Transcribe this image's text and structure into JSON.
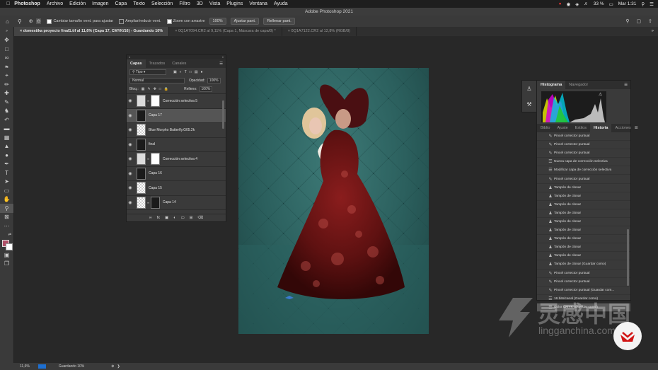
{
  "menubar": {
    "app": "Photoshop",
    "items": [
      "Archivo",
      "Edición",
      "Imagen",
      "Capa",
      "Texto",
      "Selección",
      "Filtro",
      "3D",
      "Vista",
      "Plugins",
      "Ventana",
      "Ayuda"
    ],
    "battery": "33 %",
    "clock": "Mar 1:31"
  },
  "window": {
    "title": "Adobe Photoshop 2021"
  },
  "options": {
    "resize_windows": "Cambiar tamaño vent. para ajustar",
    "zoom_all": "Ampliar/reducir vent.",
    "scrubby": "Zoom con arrastre",
    "zoom_value": "100%",
    "fit_screen": "Ajustar pant.",
    "fill_screen": "Rellenar pant."
  },
  "tabs": [
    "domestika proyecto final1.tif al 11,6% (Capa 17, CMYK/16) - Guardando 10%",
    "0Q1A7094.CR2 al 9,11% (Capa 1, Máscara de capa/8) *",
    "0Q1A7122.CR2 al 12,8% (RGB/8)"
  ],
  "layers_panel": {
    "tabs": [
      "Capas",
      "Trazados",
      "Canales"
    ],
    "filter": "Tipo",
    "blend_mode": "Normal",
    "opacity_label": "Opacidad:",
    "opacity_value": "100%",
    "lock_label": "Bloq.:",
    "fill_label": "Relleno:",
    "fill_value": "100%",
    "layers": [
      {
        "name": "Corrección selectiva 5",
        "kind": "adj"
      },
      {
        "name": "Capa 17",
        "kind": "dark"
      },
      {
        "name": "Blue Morpho Butterfly.G05.2k",
        "kind": "trans"
      },
      {
        "name": "final",
        "kind": "dark"
      },
      {
        "name": "Corrección selectiva 4",
        "kind": "adj"
      },
      {
        "name": "Capa 16",
        "kind": "dark"
      },
      {
        "name": "Capa 15",
        "kind": "trans"
      },
      {
        "name": "Capa 14",
        "kind": "mask"
      }
    ]
  },
  "histogram_panel": {
    "tabs": [
      "Histograma",
      "Navegador"
    ]
  },
  "history_panel": {
    "tabs": [
      "Biblio",
      "Ajuste",
      "Estilos",
      "Historia",
      "Acciones"
    ],
    "items": [
      {
        "label": "Pincel corrector puntual",
        "icon": "brush-icon"
      },
      {
        "label": "Pincel corrector puntual",
        "icon": "brush-icon"
      },
      {
        "label": "Pincel corrector puntual",
        "icon": "brush-icon"
      },
      {
        "label": "Nueva capa de corrección selectiva",
        "icon": "doc-icon"
      },
      {
        "label": "Modificar capa de corrección selectiva",
        "icon": "doc-icon"
      },
      {
        "label": "Pincel corrector puntual",
        "icon": "brush-icon"
      },
      {
        "label": "Tampón de clonar",
        "icon": "stamp-icon"
      },
      {
        "label": "Tampón de clonar",
        "icon": "stamp-icon"
      },
      {
        "label": "Tampón de clonar",
        "icon": "stamp-icon"
      },
      {
        "label": "Tampón de clonar",
        "icon": "stamp-icon"
      },
      {
        "label": "Tampón de clonar",
        "icon": "stamp-icon"
      },
      {
        "label": "Tampón de clonar",
        "icon": "stamp-icon"
      },
      {
        "label": "Tampón de clonar",
        "icon": "stamp-icon"
      },
      {
        "label": "Tampón de clonar",
        "icon": "stamp-icon"
      },
      {
        "label": "Tampón de clonar",
        "icon": "stamp-icon"
      },
      {
        "label": "Tampón de clonar (Guardar como)",
        "icon": "stamp-icon"
      },
      {
        "label": "Pincel corrector puntual",
        "icon": "brush-icon"
      },
      {
        "label": "Pincel corrector puntual",
        "icon": "brush-icon"
      },
      {
        "label": "Pincel corrector puntual (Guardar com...",
        "icon": "brush-icon"
      },
      {
        "label": "16 bits/canal (Guardar como)",
        "icon": "doc-icon"
      },
      {
        "label": "Color CMYK (Guardar como)",
        "icon": "doc-icon"
      }
    ]
  },
  "watermark": {
    "text_cn": "灵感中国",
    "text_en": "lingganchina.com"
  },
  "statusbar": {
    "zoom": "11,6%",
    "status": "Guardando 10%"
  },
  "colors": {
    "accent": "#1d6fd1",
    "canvas_teal": "#2e6664",
    "dress": "#6b1414"
  }
}
